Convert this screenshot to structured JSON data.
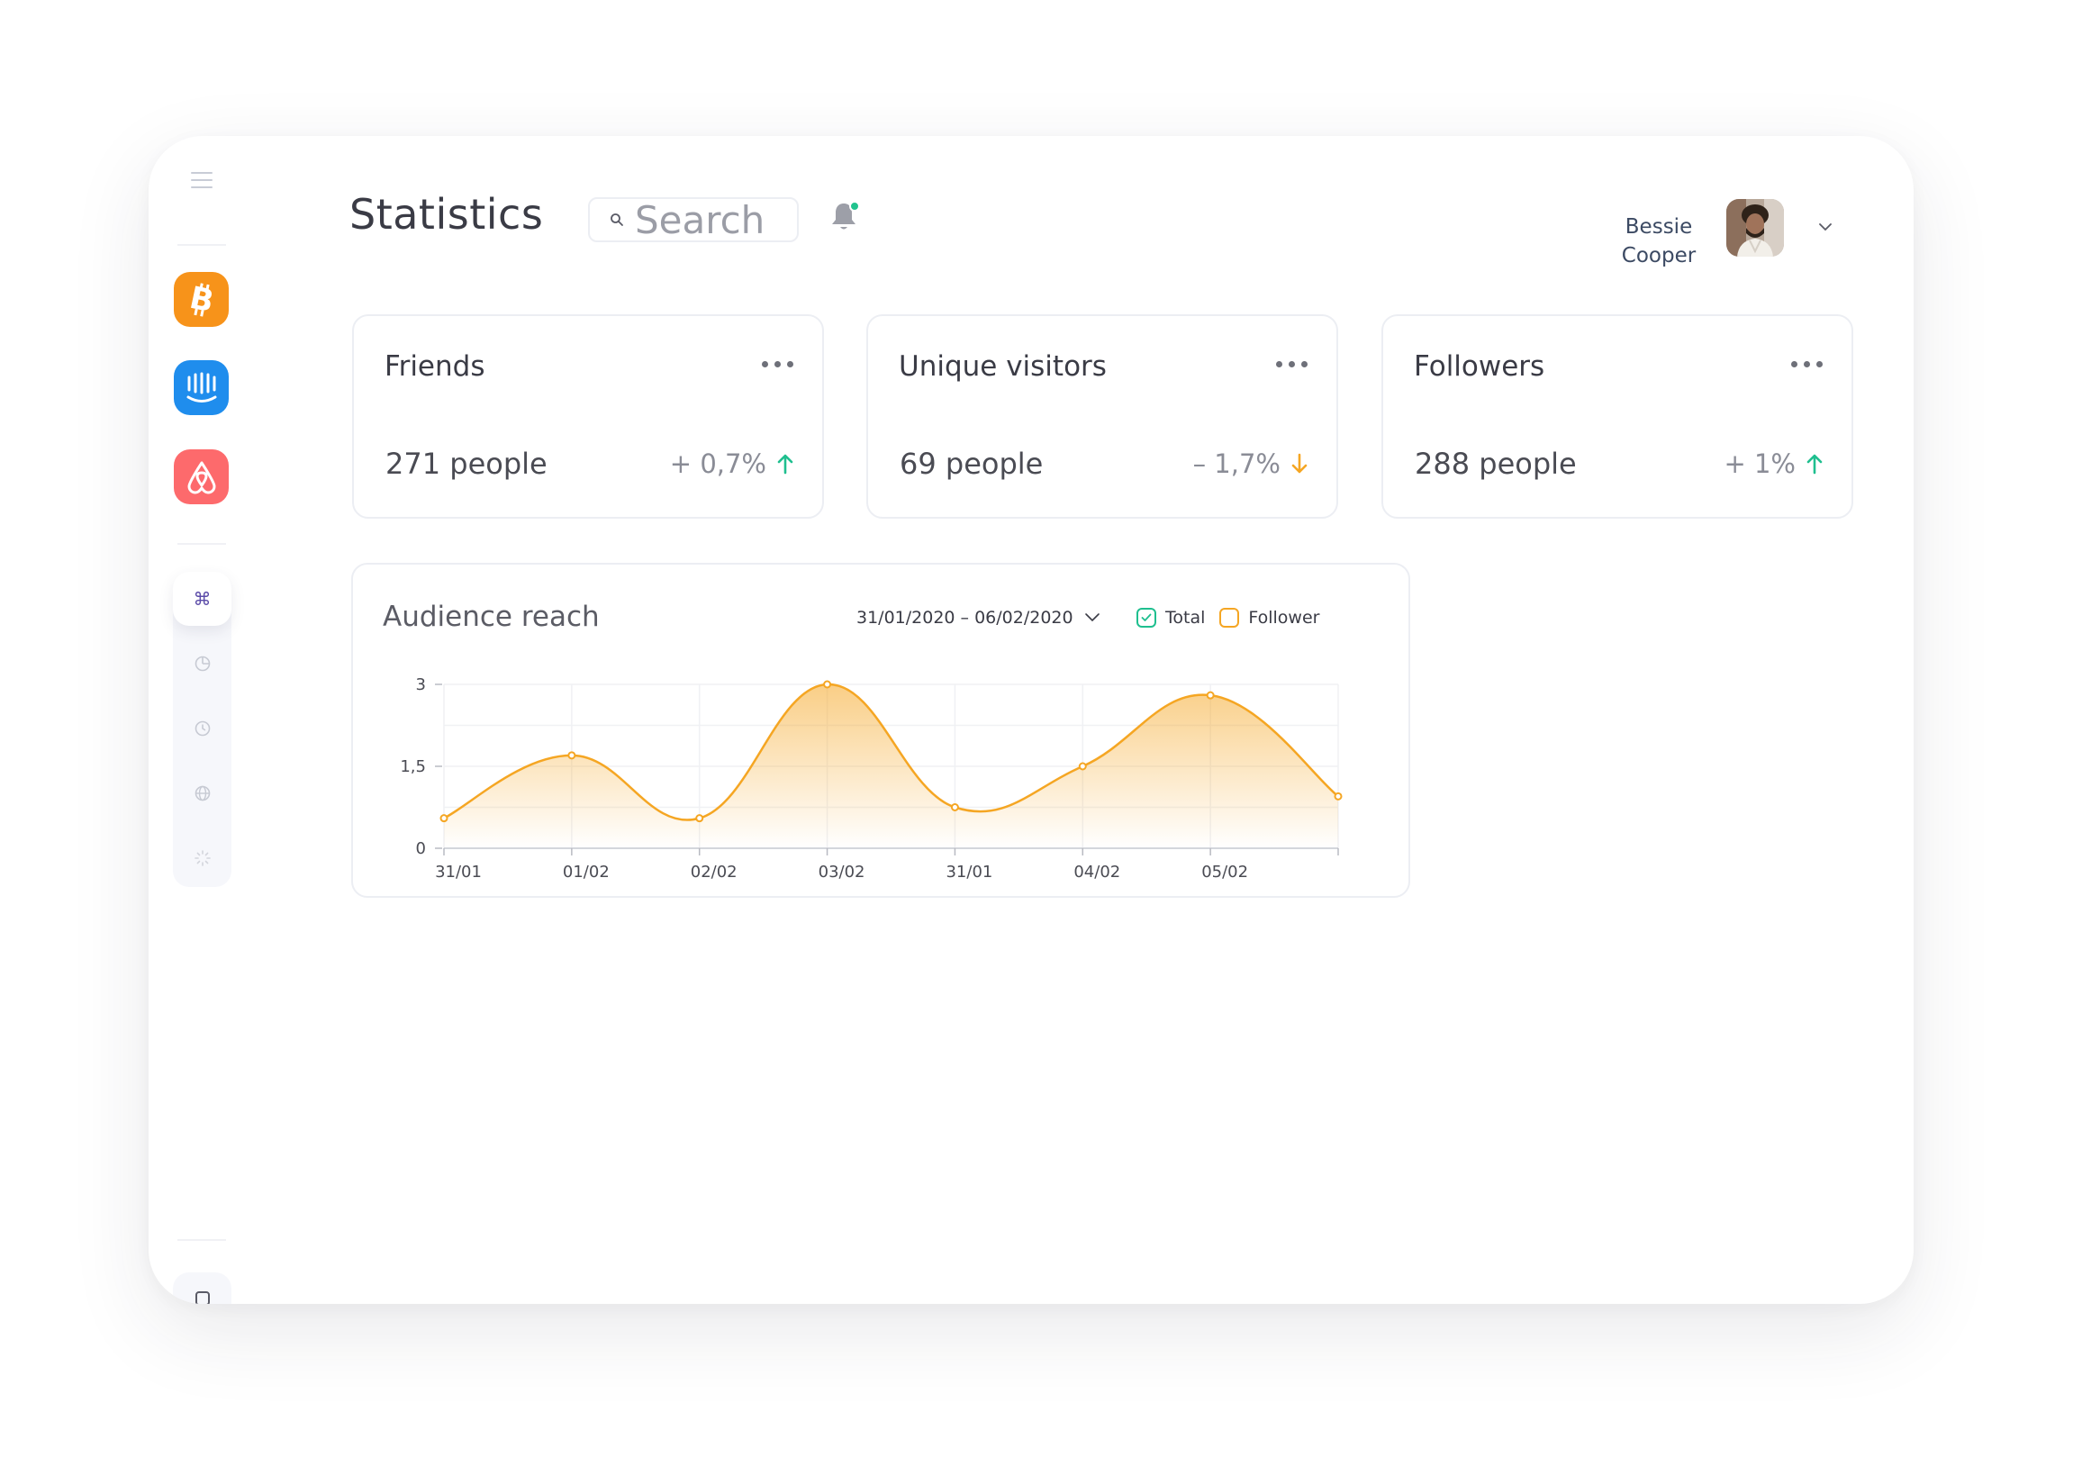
{
  "header": {
    "title": "Statistics",
    "search_placeholder": "Search",
    "user_name_first": "Bessie",
    "user_name_last": "Cooper",
    "notification_dot_color": "#22c38e"
  },
  "sidebar": {
    "apps": [
      {
        "name": "bitcoin",
        "icon": "bitcoin-icon",
        "color": "#f7931a"
      },
      {
        "name": "intercom",
        "icon": "intercom-icon",
        "color": "#1f8ded"
      },
      {
        "name": "airbnb",
        "icon": "airbnb-icon",
        "color": "#ff5a5f"
      }
    ],
    "tools": [
      "command-icon",
      "pie-chart-icon",
      "clock-icon",
      "globe-icon",
      "loader-icon"
    ],
    "active_tool": "command-icon",
    "active_tool_glyph": "⌘"
  },
  "stats": [
    {
      "title": "Friends",
      "value": "271 people",
      "change": "+ 0,7%",
      "direction": "up"
    },
    {
      "title": "Unique visitors",
      "value": "69 people",
      "change": "– 1,7%",
      "direction": "down"
    },
    {
      "title": "Followers",
      "value": "288 people",
      "change": "+ 1%",
      "direction": "up"
    }
  ],
  "colors": {
    "up": "#1fbf8f",
    "down": "#f5a623",
    "series": "#f5a623",
    "total": "#1fbf8f"
  },
  "chart": {
    "title": "Audience reach",
    "date_range": "31/01/2020 – 06/02/2020",
    "legend": [
      {
        "label": "Total",
        "checked": true,
        "color": "#1fbf8f"
      },
      {
        "label": "Follower",
        "checked": false,
        "color": "#f5a623"
      }
    ]
  },
  "chart_data": {
    "type": "area",
    "title": "Audience reach",
    "categories": [
      "31/01",
      "01/02",
      "02/02",
      "03/02",
      "31/01",
      "04/02",
      "05/02"
    ],
    "x": [
      0,
      1,
      2,
      3,
      4,
      5,
      6,
      7
    ],
    "series": [
      {
        "name": "Follower",
        "values": [
          0.55,
          1.7,
          0.55,
          3.0,
          0.75,
          1.5,
          2.8,
          0.95
        ]
      }
    ],
    "y_ticks": [
      "0",
      "1,5",
      "3"
    ],
    "ylim": [
      0,
      3
    ],
    "grid": true,
    "legend_position": "top-right"
  }
}
